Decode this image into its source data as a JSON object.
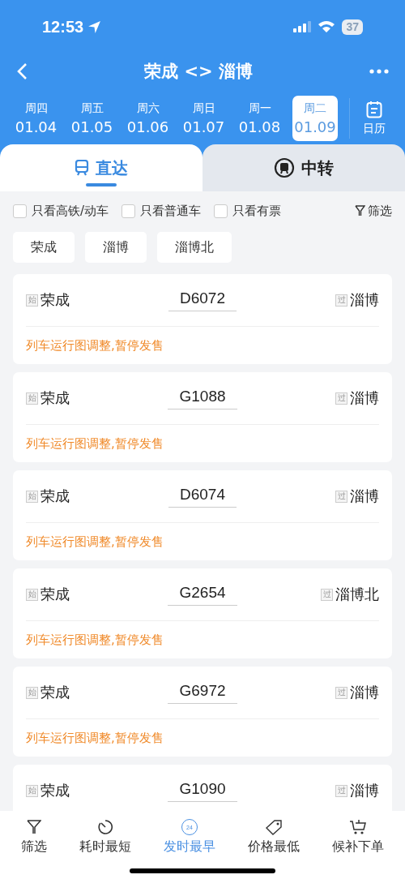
{
  "status_bar": {
    "time": "12:53",
    "battery": "37"
  },
  "header": {
    "title": "荣成 <> 淄博"
  },
  "dates": [
    {
      "weekday": "周四",
      "date": "01.04",
      "selected": false
    },
    {
      "weekday": "周五",
      "date": "01.05",
      "selected": false
    },
    {
      "weekday": "周六",
      "date": "01.06",
      "selected": false
    },
    {
      "weekday": "周日",
      "date": "01.07",
      "selected": false
    },
    {
      "weekday": "周一",
      "date": "01.08",
      "selected": false
    },
    {
      "weekday": "周二",
      "date": "01.09",
      "selected": true
    }
  ],
  "calendar": {
    "label": "日历"
  },
  "tabs": [
    {
      "label": "直达",
      "kind": "direct",
      "selected": true
    },
    {
      "label": "中转",
      "kind": "transfer",
      "selected": false
    }
  ],
  "filters": [
    {
      "label": "只看高铁/动车",
      "checked": false
    },
    {
      "label": "只看普通车",
      "checked": false
    },
    {
      "label": "只看有票",
      "checked": false
    }
  ],
  "filter_button": "筛选",
  "stations": [
    "荣成",
    "淄博",
    "淄博北"
  ],
  "trains": [
    {
      "from_badge": "始",
      "from": "荣成",
      "number": "D6072",
      "to_badge": "过",
      "to": "淄博",
      "message": "列车运行图调整,暂停发售"
    },
    {
      "from_badge": "始",
      "from": "荣成",
      "number": "G1088",
      "to_badge": "过",
      "to": "淄博",
      "message": "列车运行图调整,暂停发售"
    },
    {
      "from_badge": "始",
      "from": "荣成",
      "number": "D6074",
      "to_badge": "过",
      "to": "淄博",
      "message": "列车运行图调整,暂停发售"
    },
    {
      "from_badge": "始",
      "from": "荣成",
      "number": "G2654",
      "to_badge": "过",
      "to": "淄博北",
      "message": "列车运行图调整,暂停发售"
    },
    {
      "from_badge": "始",
      "from": "荣成",
      "number": "G6972",
      "to_badge": "过",
      "to": "淄博",
      "message": "列车运行图调整,暂停发售"
    },
    {
      "from_badge": "始",
      "from": "荣成",
      "number": "G1090",
      "to_badge": "过",
      "to": "淄博"
    }
  ],
  "bottom_bar": [
    {
      "label": "筛选",
      "kind": "filter",
      "selected": false
    },
    {
      "label": "耗时最短",
      "kind": "timer",
      "selected": false
    },
    {
      "label": "发时最早",
      "kind": "clock",
      "icon_text": "24",
      "selected": true
    },
    {
      "label": "价格最低",
      "kind": "tag",
      "selected": false
    },
    {
      "label": "候补下单",
      "kind": "cart",
      "selected": false
    }
  ]
}
